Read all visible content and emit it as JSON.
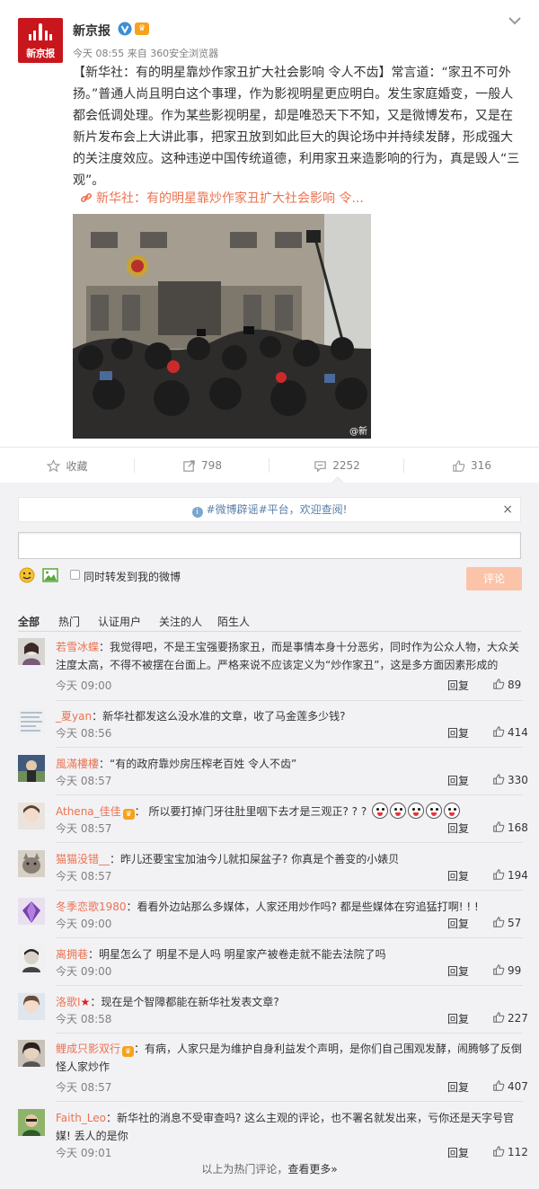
{
  "post": {
    "author": "新京报",
    "avatar_text": "新京报",
    "meta": "今天 08:55 来自 360安全浏览器",
    "text": "【新华社：有的明星靠炒作家丑扩大社会影响 令人不齿】常言道：“家丑不可外扬。”普通人尚且明白这个事理，作为影视明星更应明白。发生家庭婚变，一般人都会低调处理。作为某些影视明星，却是唯恐天下不知，又是微博发布，又是在新片发布会上大讲此事，把家丑放到如此巨大的舆论场中并持续发酵，形成强大的关注度效应。这种违逆中国传统道德，利用家丑来造影响的行为，真是毁人“三观”。",
    "link_text": "新华社：有的明星靠炒作家丑扩大社会影响 令...",
    "photo_watermark": "@新"
  },
  "actions": {
    "favorite": "收藏",
    "repost": "798",
    "comment": "2252",
    "like": "316"
  },
  "comment_box": {
    "notice_text": "#微博辟谣#平台，欢迎查阅!",
    "notice_close": "×",
    "repost_label": "同时转发到我的微博",
    "submit": "评论"
  },
  "filters": [
    "全部",
    "热门",
    "认证用户",
    "关注的人",
    "陌生人"
  ],
  "comments": [
    {
      "user": "若雪冰蝶",
      "text": "：我觉得吧，不是王宝强要扬家丑，而是事情本身十分恶劣，同时作为公众人物，大众关注度太高，不得不被摆在台面上。严格来说不应该定义为“炒作家丑”，这是多方面因素形成的",
      "time": "今天 09:00",
      "reply": "回复",
      "likes": "89"
    },
    {
      "user": "_夏yan",
      "text": "：新华社都发这么没水准的文章，收了马金莲多少钱?",
      "time": "今天 08:56",
      "reply": "回复",
      "likes": "414"
    },
    {
      "user": "風滿樓樓",
      "text": "：“有的政府靠炒房压榨老百姓 令人不齿”",
      "time": "今天 08:57",
      "reply": "回复",
      "likes": "330"
    },
    {
      "user": "Athena_佳佳",
      "text": "： 所以要打掉门牙往肚里咽下去才是三观正? ? ?",
      "time": "今天 08:57",
      "reply": "回复",
      "likes": "168"
    },
    {
      "user": "猫猫没错__",
      "text": "：昨儿还要宝宝加油今儿就扣屎盆子? 你真是个善变的小婊贝",
      "time": "今天 08:57",
      "reply": "回复",
      "likes": "194"
    },
    {
      "user": "冬季恋歌1980",
      "text": "：看看外边站那么多媒体，人家还用炒作吗? 都是些媒体在穷追猛打啊! ! !",
      "time": "今天 09:00",
      "reply": "回复",
      "likes": "57"
    },
    {
      "user": "离拥巷",
      "text": "：明星怎么了 明星不是人吗 明星家产被卷走就不能去法院了吗",
      "time": "今天 09:00",
      "reply": "回复",
      "likes": "99"
    },
    {
      "user": "洛歌I",
      "text": "：现在是个智障都能在新华社发表文章?",
      "time": "今天 08:58",
      "reply": "回复",
      "likes": "227"
    },
    {
      "user": "鲤成只影双行",
      "text": "：有病，人家只是为维护自身利益发个声明，是你们自己围观发酵，闹腾够了反倒怪人家炒作",
      "time": "今天 08:57",
      "reply": "回复",
      "likes": "407"
    },
    {
      "user": "Faith_Leo",
      "text": "：新华社的消息不受审查吗? 这么主观的评论，也不署名就发出来，亏你还是天字号官媒! 丢人的是你",
      "time": "今天 09:01",
      "reply": "回复",
      "likes": "112"
    }
  ],
  "footer": {
    "prefix": "以上为热门评论，",
    "link": "查看更多»"
  }
}
